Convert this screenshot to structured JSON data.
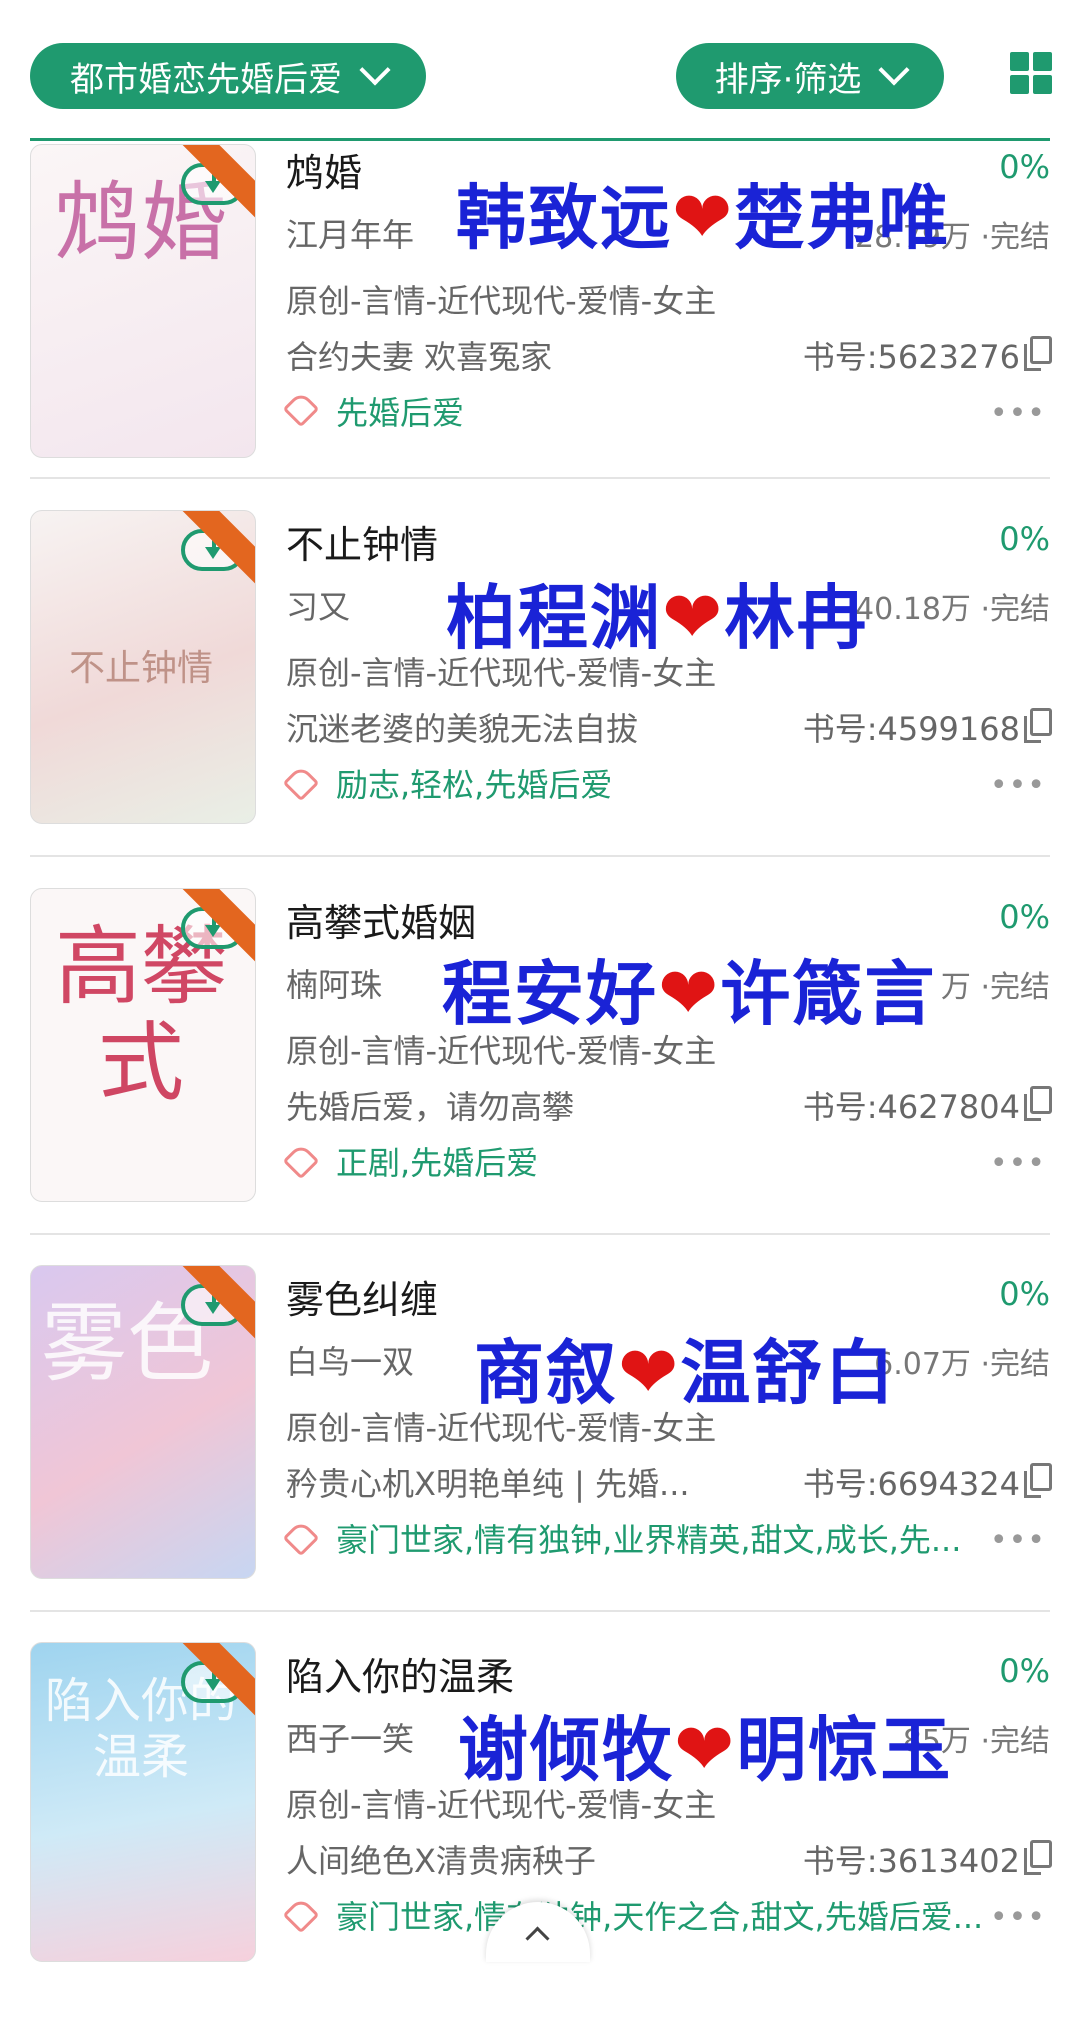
{
  "filter": {
    "category": "都市婚恋先婚后爱",
    "sort": "排序·筛选"
  },
  "icons": {
    "layout": "grid-view-icon",
    "download": "cloud-download-icon",
    "copy": "copy-icon",
    "tag": "tag-icon",
    "more": "more-icon"
  },
  "colors": {
    "accent": "#1f9a6f",
    "overlay_text": "#1a23d6",
    "heart": "#e01414"
  },
  "books": [
    {
      "title": "鸩婚",
      "cover_text": "鸩婚",
      "progress": "0%",
      "author": "江月年年",
      "words_status": "28.79万 ·完结",
      "category": "原创-言情-近代现代-爱情-女主",
      "blurb": "合约夫妻 欢喜冤家",
      "book_id": "书号:5623276",
      "tags": "先婚后爱",
      "overlay": {
        "left": "韩致远",
        "right": "楚弗唯"
      }
    },
    {
      "title": "不止钟情",
      "cover_text": "不止钟情",
      "progress": "0%",
      "author": "习又",
      "words_status": "40.18万 ·完结",
      "category": "原创-言情-近代现代-爱情-女主",
      "blurb": "沉迷老婆的美貌无法自拔",
      "book_id": "书号:4599168",
      "tags": "励志,轻松,先婚后爱",
      "overlay": {
        "left": "柏程渊",
        "right": "林冉"
      }
    },
    {
      "title": "高攀式婚姻",
      "cover_text": "高攀式",
      "progress": "0%",
      "author": "楠阿珠",
      "words_status": "万 ·完结",
      "category": "原创-言情-近代现代-爱情-女主",
      "blurb": "先婚后爱，请勿高攀",
      "book_id": "书号:4627804",
      "tags": "正剧,先婚后爱",
      "overlay": {
        "left": "程安好",
        "right": "许箴言"
      }
    },
    {
      "title": "雾色纠缠",
      "cover_text": "雾色",
      "progress": "0%",
      "author": "白鸟一双",
      "words_status": "6.07万 ·完结",
      "category": "原创-言情-近代现代-爱情-女主",
      "blurb": "矜贵心机X明艳单纯 | 先婚...",
      "book_id": "书号:6694324",
      "tags": "豪门世家,情有独钟,业界精英,甜文,成长,先...",
      "overlay": {
        "left": "商叙",
        "right": "温舒白"
      }
    },
    {
      "title": "陷入你的温柔",
      "cover_text": "陷入你的温柔",
      "progress": "0%",
      "author": "西子一笑",
      "words_status": "85万 ·完结",
      "category": "原创-言情-近代现代-爱情-女主",
      "blurb": "人间绝色X清贵病秧子",
      "book_id": "书号:3613402",
      "tags": "豪门世家,情有独钟,天作之合,甜文,先婚后爱...",
      "overlay": {
        "left": "谢倾牧",
        "right": "明惊玉"
      }
    }
  ]
}
